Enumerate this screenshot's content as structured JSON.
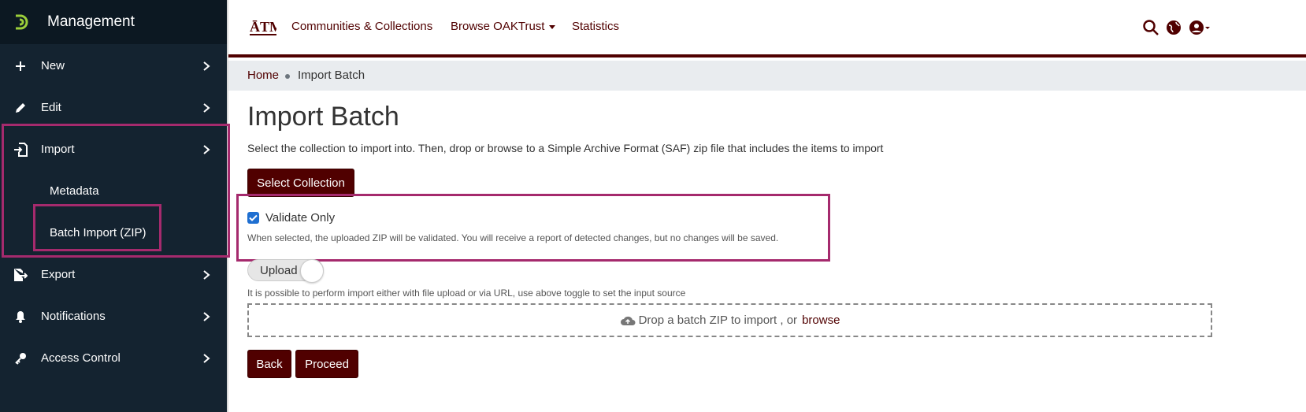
{
  "sidebar": {
    "title": "Management",
    "items": [
      {
        "label": "New",
        "icon": "plus-icon"
      },
      {
        "label": "Edit",
        "icon": "pencil-icon"
      },
      {
        "label": "Import",
        "icon": "import-icon"
      },
      {
        "label": "Export",
        "icon": "export-icon"
      },
      {
        "label": "Notifications",
        "icon": "bell-icon"
      },
      {
        "label": "Access Control",
        "icon": "key-icon"
      }
    ],
    "import_sub": [
      "Metadata",
      "Batch Import (ZIP)"
    ]
  },
  "header": {
    "nav": [
      "Communities & Collections",
      "Browse OAKTrust",
      "Statistics"
    ]
  },
  "breadcrumb": {
    "home": "Home",
    "current": "Import Batch"
  },
  "main": {
    "title": "Import Batch",
    "description": "Select the collection to import into. Then, drop or browse to a Simple Archive Format (SAF) zip file that includes the items to import",
    "select_collection": "Select Collection",
    "validate_label": "Validate Only",
    "validate_checked": true,
    "validate_help": "When selected, the uploaded ZIP will be validated. You will receive a report of detected changes, but no changes will be saved.",
    "toggle_label": "Upload",
    "toggle_help": "It is possible to perform import either with file upload or via URL, use above toggle to set the input source",
    "drop_text": "Drop a batch ZIP to import , or",
    "browse": "browse",
    "back": "Back",
    "proceed": "Proceed"
  },
  "colors": {
    "brand": "#500000",
    "sidebar": "#142330",
    "highlight": "#a52a6d",
    "checkbox": "#1f6fd1"
  }
}
